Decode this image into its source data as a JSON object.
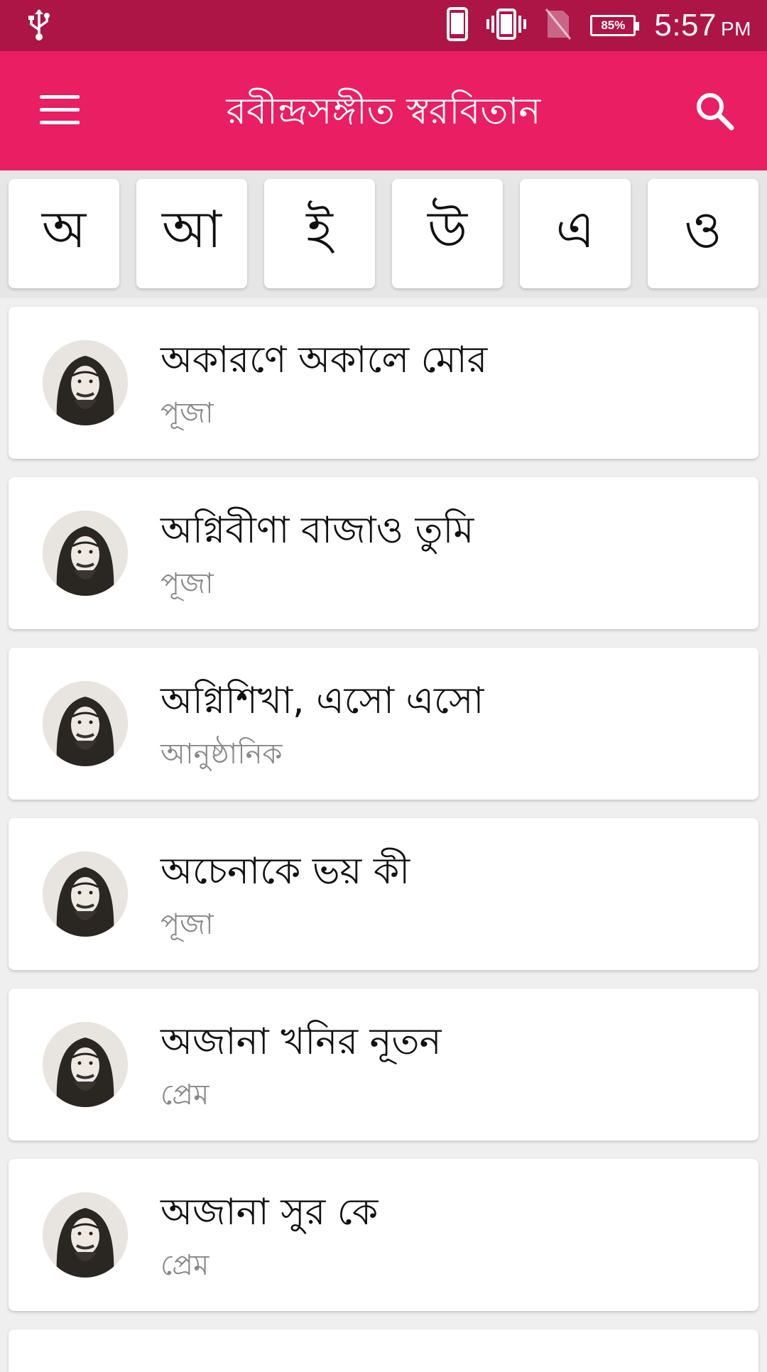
{
  "status_bar": {
    "time": "5:57",
    "ampm": "PM",
    "battery": "85%",
    "icons": [
      "usb-icon",
      "phone-icon",
      "vibrate-icon",
      "no-sim-icon",
      "battery-icon"
    ]
  },
  "app_bar": {
    "title": "রবীন্দ্রসঙ্গীত স্বরবিতান",
    "icons": [
      "menu-icon",
      "search-icon"
    ]
  },
  "letters": [
    "অ",
    "আ",
    "ই",
    "উ",
    "এ",
    "ও"
  ],
  "songs": [
    {
      "title": "অকারণে অকালে মোর",
      "category": "পূজা"
    },
    {
      "title": "অগ্নিবীণা বাজাও তুমি",
      "category": "পূজা"
    },
    {
      "title": "অগ্নিশিখা, এসো এসো",
      "category": "আনুষ্ঠানিক"
    },
    {
      "title": "অচেনাকে ভয় কী",
      "category": "পূজা"
    },
    {
      "title": "অজানা খনির নূতন",
      "category": "প্রেম"
    },
    {
      "title": "অজানা সুর কে",
      "category": "প্রেম"
    }
  ],
  "colors": {
    "status_bar": "#ad1547",
    "app_bar": "#e91e63",
    "background": "#efefef"
  }
}
